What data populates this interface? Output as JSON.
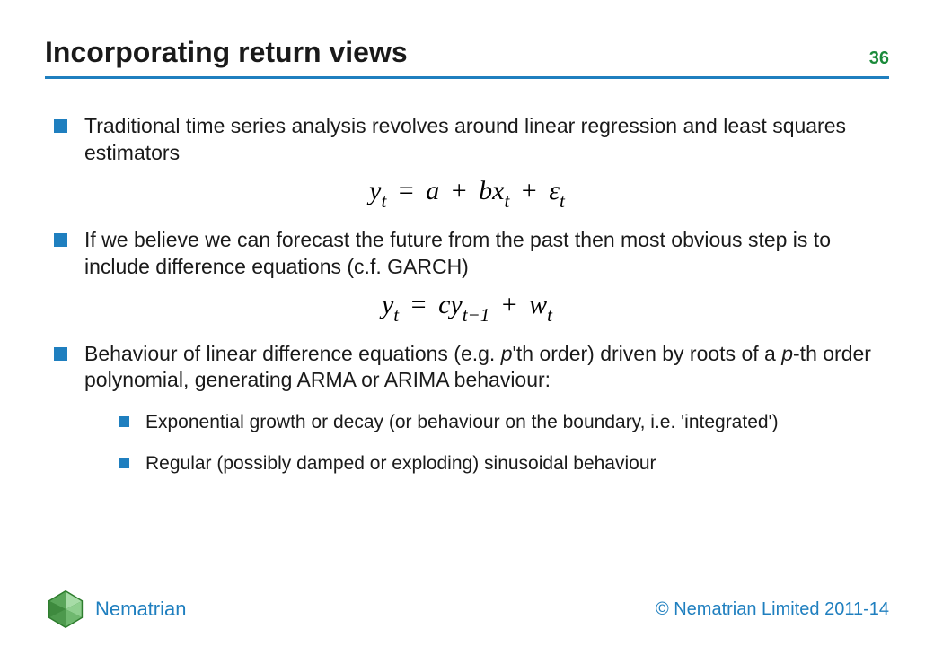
{
  "header": {
    "title": "Incorporating return views",
    "page_number": "36"
  },
  "bullets": [
    "Traditional time series analysis revolves around linear regression and least squares estimators",
    "If we believe we can forecast the future from the past then most obvious step is to include difference equations (c.f. GARCH)",
    "Behaviour of linear difference equations (e.g. p'th order) driven by roots of a p-th order polynomial, generating ARMA or ARIMA behaviour:"
  ],
  "subbullets": [
    "Exponential growth or decay (or behaviour on the boundary, i.e. 'integrated')",
    "Regular (possibly damped or exploding) sinusoidal behaviour"
  ],
  "equations": {
    "eq1": {
      "lhs_var": "y",
      "lhs_sub": "t",
      "a": "a",
      "b": "b",
      "x": "x",
      "xsub": "t",
      "eps": "ε",
      "epssub": "t",
      "plain": "y_t = a + b x_t + ε_t"
    },
    "eq2": {
      "lhs_var": "y",
      "lhs_sub": "t",
      "c": "c",
      "y2": "y",
      "y2sub": "t−1",
      "w": "w",
      "wsub": "t",
      "plain": "y_t = c y_{t-1} + w_t"
    }
  },
  "footer": {
    "brand": "Nematrian",
    "copyright": "© Nematrian Limited 2011-14"
  },
  "colors": {
    "accent": "#1f7fbf",
    "pagenum": "#1a8a3a"
  }
}
